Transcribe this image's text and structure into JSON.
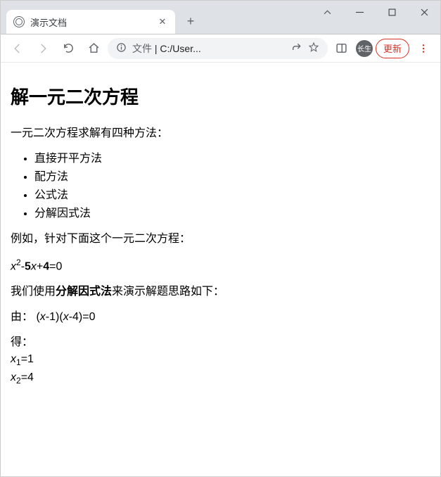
{
  "browser": {
    "tab_title": "演示文档",
    "address_prefix": "文件",
    "address_text": "C:/User...",
    "avatar_text": "长生",
    "update_label": "更新"
  },
  "doc": {
    "h1": "解一元二次方程",
    "intro": "一元二次方程求解有四种方法：",
    "methods": [
      "直接开平方法",
      "配方法",
      "公式法",
      "分解因式法"
    ],
    "example_lead": "例如，针对下面这个一元二次方程：",
    "equation": {
      "a": "x",
      "exp": "2",
      "b_coef": "5",
      "b_var": "x",
      "c": "4",
      "rhs": "0"
    },
    "solve_lead_1": "我们使用",
    "solve_bold": "分解因式法",
    "solve_lead_2": "来演示解题思路如下：",
    "step1_label": "由：",
    "step1_expr_a": "(",
    "step1_var1": "x",
    "step1_mid1": "-1)(",
    "step1_var2": "x",
    "step1_mid2": "-4)=0",
    "step2_label": "得：",
    "root1_var": "x",
    "root1_sub": "1",
    "root1_val": "=1",
    "root2_var": "x",
    "root2_sub": "2",
    "root2_val": "=4"
  }
}
